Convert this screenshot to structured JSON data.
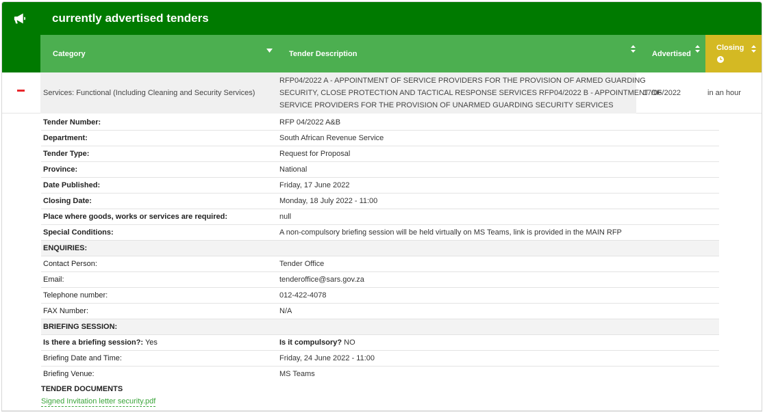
{
  "header": {
    "title": "currently advertised tenders",
    "icon": "megaphone-icon"
  },
  "columns": {
    "category": "Category",
    "description": "Tender Description",
    "advertised": "Advertised",
    "closing": "Closing"
  },
  "colors": {
    "title_bar": "#007a00",
    "header_row": "#4caf50",
    "closing_header": "#d4b923",
    "collapse_icon": "#e8262b",
    "link": "#3aa53a"
  },
  "tender": {
    "category": "Services: Functional (Including Cleaning and Security Services)",
    "description_lines": [
      "RFP04/2022 A - APPOINTMENT OF SERVICE PROVIDERS FOR THE PROVISION OF ARMED GUARDING",
      "SECURITY, CLOSE PROTECTION AND TACTICAL RESPONSE SERVICES RFP04/2022 B - APPOINTMENT OF",
      "SERVICE PROVIDERS FOR THE PROVISION OF UNARMED GUARDING SECURITY SERVICES"
    ],
    "advertised": "17/06/2022",
    "closing": "in an hour"
  },
  "details": [
    {
      "label": "Tender Number:",
      "value": "RFP 04/2022 A&B",
      "bold": true
    },
    {
      "label": "Department:",
      "value": "South African Revenue Service",
      "bold": true
    },
    {
      "label": "Tender Type:",
      "value": "Request for Proposal",
      "bold": true
    },
    {
      "label": "Province:",
      "value": "National",
      "bold": true
    },
    {
      "label": "Date Published:",
      "value": "Friday, 17 June 2022",
      "bold": true
    },
    {
      "label": "Closing Date:",
      "value": "Monday, 18 July 2022 - 11:00",
      "bold": true
    },
    {
      "label": "Place where goods, works or services are required:",
      "value": "null",
      "bold": true
    },
    {
      "label": "Special Conditions:",
      "value": "A non-compulsory briefing session will be held virtually on MS Teams, link is provided in the MAIN RFP",
      "bold": true
    },
    {
      "label": "ENQUIRIES:",
      "value": "",
      "bold": true,
      "shaded": true
    },
    {
      "label": "Contact Person:",
      "value": "Tender Office",
      "bold": false
    },
    {
      "label": "Email:",
      "value": "tenderoffice@sars.gov.za",
      "bold": false
    },
    {
      "label": "Telephone number:",
      "value": "012-422-4078",
      "bold": false
    },
    {
      "label": "FAX Number:",
      "value": "N/A",
      "bold": false
    },
    {
      "label": "BRIEFING SESSION:",
      "value": "",
      "bold": true,
      "shaded": true
    }
  ],
  "briefing": {
    "question_label": "Is there a briefing session?:",
    "question_value": "Yes",
    "compulsory_label": "Is it compulsory?",
    "compulsory_value": "NO",
    "date_label": "Briefing Date and Time:",
    "date_value": "Friday, 24 June 2022 - 11:00",
    "venue_label": "Briefing Venue:",
    "venue_value": "MS Teams"
  },
  "documents": {
    "heading": "TENDER DOCUMENTS",
    "files": [
      "Signed Invitation letter security.pdf"
    ]
  }
}
